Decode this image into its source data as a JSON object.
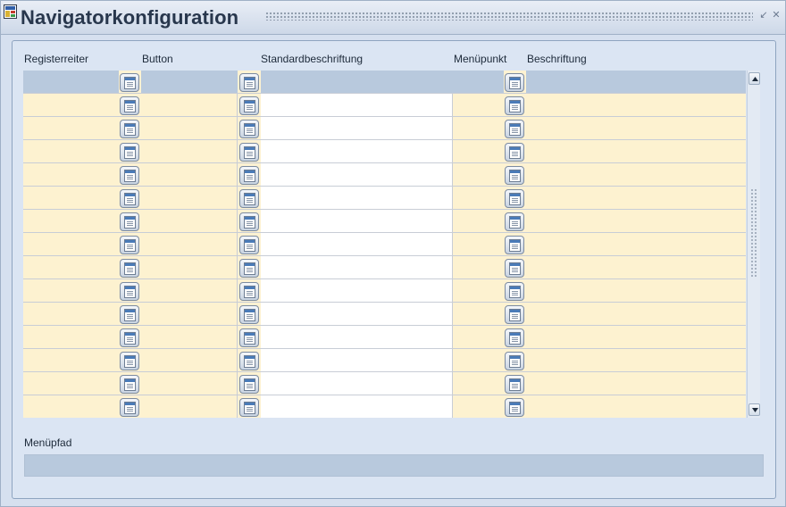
{
  "window": {
    "title": "Navigatorkonfiguration",
    "icon": "form-icon"
  },
  "columns": {
    "registerreiter": "Registerreiter",
    "button": "Button",
    "standardbeschriftung": "Standardbeschriftung",
    "menuepunkt": "Menüpunkt",
    "beschriftung": "Beschriftung"
  },
  "grid": {
    "visible_rows": 15,
    "selected_row": 1,
    "rows": [
      {
        "registerreiter": "",
        "button": "",
        "standardbeschriftung": "",
        "menuepunkt": "",
        "beschriftung": ""
      },
      {
        "registerreiter": "",
        "button": "",
        "standardbeschriftung": "",
        "menuepunkt": "",
        "beschriftung": ""
      },
      {
        "registerreiter": "",
        "button": "",
        "standardbeschriftung": "",
        "menuepunkt": "",
        "beschriftung": ""
      },
      {
        "registerreiter": "",
        "button": "",
        "standardbeschriftung": "",
        "menuepunkt": "",
        "beschriftung": ""
      },
      {
        "registerreiter": "",
        "button": "",
        "standardbeschriftung": "",
        "menuepunkt": "",
        "beschriftung": ""
      },
      {
        "registerreiter": "",
        "button": "",
        "standardbeschriftung": "",
        "menuepunkt": "",
        "beschriftung": ""
      },
      {
        "registerreiter": "",
        "button": "",
        "standardbeschriftung": "",
        "menuepunkt": "",
        "beschriftung": ""
      },
      {
        "registerreiter": "",
        "button": "",
        "standardbeschriftung": "",
        "menuepunkt": "",
        "beschriftung": ""
      },
      {
        "registerreiter": "",
        "button": "",
        "standardbeschriftung": "",
        "menuepunkt": "",
        "beschriftung": ""
      },
      {
        "registerreiter": "",
        "button": "",
        "standardbeschriftung": "",
        "menuepunkt": "",
        "beschriftung": ""
      },
      {
        "registerreiter": "",
        "button": "",
        "standardbeschriftung": "",
        "menuepunkt": "",
        "beschriftung": ""
      },
      {
        "registerreiter": "",
        "button": "",
        "standardbeschriftung": "",
        "menuepunkt": "",
        "beschriftung": ""
      },
      {
        "registerreiter": "",
        "button": "",
        "standardbeschriftung": "",
        "menuepunkt": "",
        "beschriftung": ""
      },
      {
        "registerreiter": "",
        "button": "",
        "standardbeschriftung": "",
        "menuepunkt": "",
        "beschriftung": ""
      },
      {
        "registerreiter": "",
        "button": "",
        "standardbeschriftung": "",
        "menuepunkt": "",
        "beschriftung": ""
      }
    ]
  },
  "menupfad": {
    "label": "Menüpfad",
    "value": ""
  },
  "icons": {
    "lov_button": "list-of-values-icon",
    "scroll_up": "arrow-up-icon",
    "scroll_down": "arrow-down-icon",
    "minimize": "minimize-icon",
    "close": "close-icon"
  },
  "colors": {
    "row_fill": "#fdf2d0",
    "selected_row": "#b8c9dd",
    "panel": "#dbe5f3",
    "title_text": "#28374d"
  }
}
